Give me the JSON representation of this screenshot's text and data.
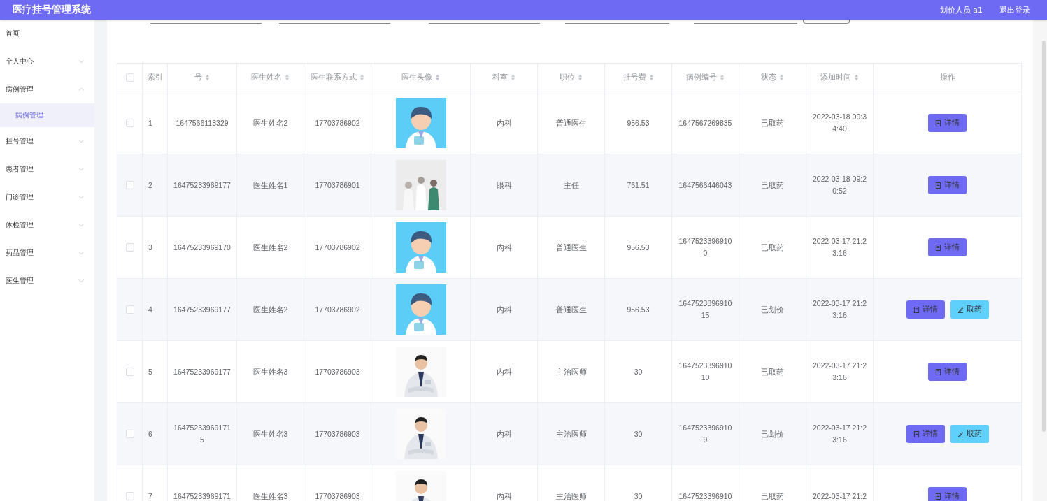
{
  "header": {
    "title": "医疗挂号管理系统",
    "user": "划价人员 a1",
    "logout": "退出登录"
  },
  "sidebar": {
    "items": [
      {
        "label": "首页",
        "expandable": false,
        "selected": false
      },
      {
        "label": "个人中心",
        "expandable": true,
        "expanded": false,
        "selected": false
      },
      {
        "label": "病例管理",
        "expandable": true,
        "expanded": true,
        "selected": false,
        "children": [
          {
            "label": "病例管理",
            "selected": true
          }
        ]
      },
      {
        "label": "挂号管理",
        "expandable": true,
        "expanded": false,
        "selected": false
      },
      {
        "label": "患者管理",
        "expandable": true,
        "expanded": false,
        "selected": false
      },
      {
        "label": "门诊管理",
        "expandable": true,
        "expanded": false,
        "selected": false
      },
      {
        "label": "体检管理",
        "expandable": true,
        "expanded": false,
        "selected": false
      },
      {
        "label": "药品管理",
        "expandable": true,
        "expanded": false,
        "selected": false
      },
      {
        "label": "医生管理",
        "expandable": true,
        "expanded": false,
        "selected": false
      }
    ]
  },
  "table": {
    "all_checked": false,
    "columns": [
      {
        "label": "索引",
        "sortable": false
      },
      {
        "label": "号",
        "sortable": true
      },
      {
        "label": "医生姓名",
        "sortable": true
      },
      {
        "label": "医生联系方式",
        "sortable": true
      },
      {
        "label": "医生头像",
        "sortable": true
      },
      {
        "label": "科室",
        "sortable": true
      },
      {
        "label": "职位",
        "sortable": true
      },
      {
        "label": "挂号费",
        "sortable": true
      },
      {
        "label": "病例编号",
        "sortable": true
      },
      {
        "label": "状态",
        "sortable": true
      },
      {
        "label": "添加时间",
        "sortable": true
      },
      {
        "label": "操作",
        "sortable": false
      }
    ],
    "rows": [
      {
        "checked": false,
        "cells": [
          "1",
          "1647566118329",
          "医生姓名2",
          "17703786902",
          {
            "kind": "picture"
          },
          "内科",
          "普通医生",
          "956.53",
          "1647567269835",
          "已取药",
          "2022-03-18 09:34:40"
        ],
        "actions": [
          {
            "kind": "detail",
            "label": "详情"
          }
        ]
      },
      {
        "checked": false,
        "cells": [
          "2",
          "16475233969177",
          "医生姓名1",
          "17703786901",
          {
            "kind": "picture"
          },
          "眼科",
          "主任",
          "761.51",
          "1647566446043",
          "已取药",
          "2022-03-18 09:20:52"
        ],
        "actions": [
          {
            "kind": "detail",
            "label": "详情"
          }
        ]
      },
      {
        "checked": false,
        "cells": [
          "3",
          "16475233969170",
          "医生姓名2",
          "17703786902",
          {
            "kind": "picture"
          },
          "内科",
          "普通医生",
          "956.53",
          "16475233969100",
          "已取药",
          "2022-03-17 21:23:16"
        ],
        "actions": [
          {
            "kind": "detail",
            "label": "详情"
          }
        ]
      },
      {
        "checked": false,
        "cells": [
          "4",
          "16475233969177",
          "医生姓名2",
          "17703786902",
          {
            "kind": "picture"
          },
          "内科",
          "普通医生",
          "956.53",
          "164752339691015",
          "已划价",
          "2022-03-17 21:23:16"
        ],
        "actions": [
          {
            "kind": "detail",
            "label": "详情"
          },
          {
            "kind": "dispense",
            "label": "取药"
          }
        ]
      },
      {
        "checked": false,
        "cells": [
          "5",
          "16475233969177",
          "医生姓名3",
          "17703786903",
          {
            "kind": "picture"
          },
          "内科",
          "主治医师",
          "30",
          "164752339691010",
          "已取药",
          "2022-03-17 21:23:16"
        ],
        "actions": [
          {
            "kind": "detail",
            "label": "详情"
          }
        ]
      },
      {
        "checked": false,
        "cells": [
          "6",
          "164752339691715",
          "医生姓名3",
          "17703786903",
          {
            "kind": "picture"
          },
          "内科",
          "主治医师",
          "30",
          "16475233969109",
          "已划价",
          "2022-03-17 21:23:16"
        ],
        "actions": [
          {
            "kind": "detail",
            "label": "详情"
          },
          {
            "kind": "dispense",
            "label": "取药"
          }
        ]
      },
      {
        "checked": false,
        "cells": [
          "7",
          "16475233969171",
          "医生姓名3",
          "17703786903",
          {
            "kind": "picture"
          },
          "内科",
          "主治医师",
          "30",
          "1647523396910",
          "已取药",
          "2022-03-17 21:2"
        ],
        "actions": [
          {
            "kind": "detail",
            "label": "详情"
          }
        ]
      }
    ]
  }
}
